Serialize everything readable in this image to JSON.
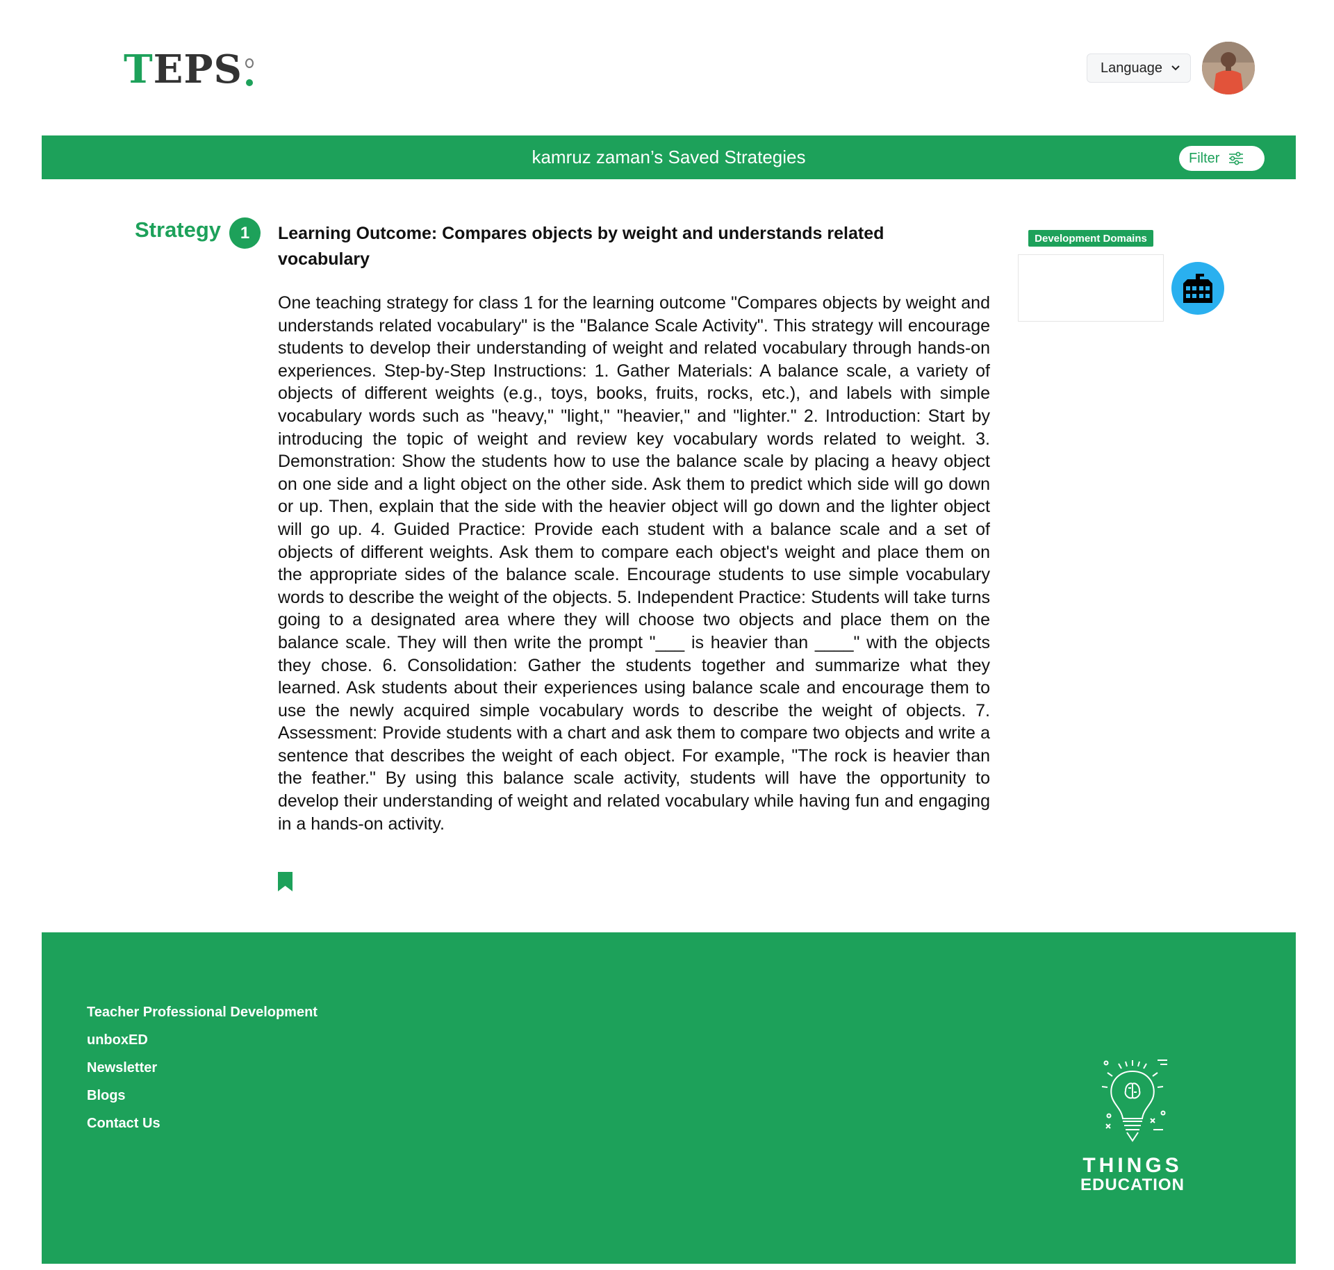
{
  "header": {
    "logo_text_first": "T",
    "logo_text_rest": "EPS",
    "language_label": "Language",
    "avatar_icon": "user-avatar"
  },
  "title_bar": {
    "title": "kamruz zaman’s Saved Strategies",
    "filter_label": "Filter",
    "filter_icon": "sliders-icon"
  },
  "strategy": {
    "label": "Strategy",
    "number": "1",
    "outcome": "Learning Outcome: Compares objects by weight and understands related vocabulary",
    "body": "One teaching strategy for class 1 for the learning outcome \"Compares objects by weight and understands related vocabulary\" is the \"Balance Scale Activity\". This strategy will encourage students to develop their understanding of weight and related vocabulary through hands-on experiences. Step-by-Step Instructions: 1. Gather Materials: A balance scale, a variety of objects of different weights (e.g., toys, books, fruits, rocks, etc.), and labels with simple vocabulary words such as \"heavy,\" \"light,\" \"heavier,\" and \"lighter.\" 2. Introduction: Start by introducing the topic of weight and review key vocabulary words related to weight. 3. Demonstration: Show the students how to use the balance scale by placing a heavy object on one side and a light object on the other side. Ask them to predict which side will go down or up. Then, explain that the side with the heavier object will go down and the lighter object will go up. 4. Guided Practice: Provide each student with a balance scale and a set of objects of different weights. Ask them to compare each object's weight and place them on the appropriate sides of the balance scale. Encourage students to use simple vocabulary words to describe the weight of the objects. 5. Independent Practice: Students will take turns going to a designated area where they will choose two objects and place them on the balance scale. They will then write the prompt \"___ is heavier than ____\" with the objects they chose. 6. Consolidation: Gather the students together and summarize what they learned. Ask students about their experiences using balance scale and encourage them to use the newly acquired simple vocabulary words to describe the weight of objects. 7. Assessment: Provide students with a chart and ask them to compare two objects and write a sentence that describes the weight of each object. For example, \"The rock is heavier than the feather.\" By using this balance scale activity, students will have the opportunity to develop their understanding of weight and related vocabulary while having fun and engaging in a hands-on activity.",
    "bookmark_icon": "bookmark-icon",
    "domains_label": "Development Domains",
    "domain_icon": "school-icon"
  },
  "footer": {
    "links": [
      "Teacher Professional Development",
      "unboxED",
      "Newsletter",
      "Blogs",
      "Contact Us"
    ],
    "brand_word1": "THINGS",
    "brand_word2": "EDUCATION",
    "brand_icon": "lightbulb-brain-icon"
  },
  "colors": {
    "brand_green": "#1da15a",
    "icon_blue": "#2ab0ef",
    "text_dark": "#111111"
  }
}
